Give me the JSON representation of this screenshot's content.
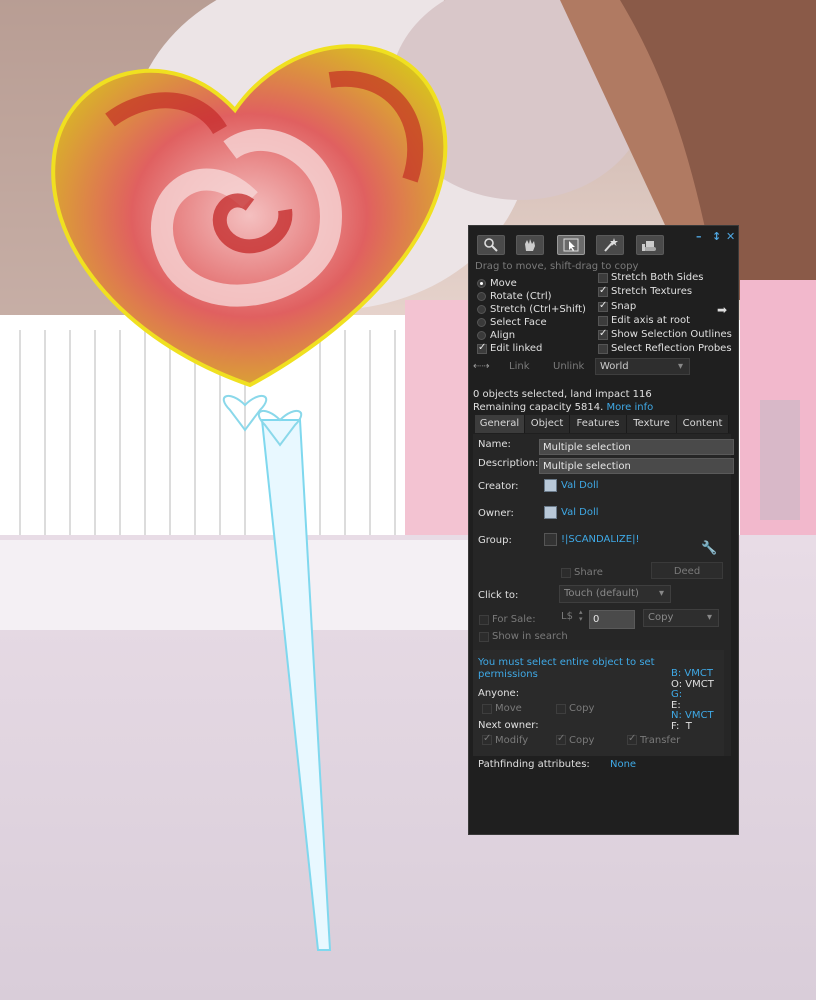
{
  "toolbar": {
    "tools": [
      {
        "icon": "magnifier-icon"
      },
      {
        "icon": "grab-hand-icon"
      },
      {
        "icon": "build-pointer-icon"
      },
      {
        "icon": "magic-wand-create-icon"
      },
      {
        "icon": "bulldozer-land-icon"
      }
    ],
    "hint": "Drag to move, shift-drag to copy"
  },
  "modes": [
    {
      "label": "Move",
      "selected": true
    },
    {
      "label": "Rotate (Ctrl)",
      "selected": false
    },
    {
      "label": "Stretch (Ctrl+Shift)",
      "selected": false
    },
    {
      "label": "Select Face",
      "selected": false
    },
    {
      "label": "Align",
      "selected": false
    }
  ],
  "edit_linked": {
    "label": "Edit linked",
    "checked": true
  },
  "options": [
    {
      "label": "Stretch Both Sides",
      "checked": false
    },
    {
      "label": "Stretch Textures",
      "checked": true
    },
    {
      "label": "Snap",
      "checked": true
    },
    {
      "label": "Edit axis at root",
      "checked": false
    },
    {
      "label": "Show Selection Outlines",
      "checked": true
    },
    {
      "label": "Select Reflection Probes",
      "checked": false
    }
  ],
  "link_row": {
    "link": "Link",
    "unlink": "Unlink",
    "ruler": "World"
  },
  "status": {
    "line1": "0 objects selected, land impact 116",
    "line2": "Remaining capacity 5814.",
    "more_info": "More info"
  },
  "tabs": [
    "General",
    "Object",
    "Features",
    "Texture",
    "Content"
  ],
  "general": {
    "name_label": "Name:",
    "name_value": "Multiple selection",
    "description_label": "Description:",
    "description_value": "Multiple selection",
    "creator_label": "Creator:",
    "creator_value": "Val Doll",
    "owner_label": "Owner:",
    "owner_value": "Val Doll",
    "group_label": "Group:",
    "group_value": "!|SCANDALIZE|!",
    "share_label": "Share",
    "deed_label": "Deed",
    "click_to_label": "Click to:",
    "click_to_value": "Touch  (default)",
    "for_sale_label": "For Sale:",
    "currency": "L$",
    "price": "0",
    "sale_type": "Copy",
    "show_in_search": "Show in search"
  },
  "permissions": {
    "notice": "You must select entire object to set permissions",
    "anyone_label": "Anyone:",
    "anyone_move": "Move",
    "anyone_copy": "Copy",
    "next_owner_label": "Next owner:",
    "next_modify": "Modify",
    "next_copy": "Copy",
    "next_transfer": "Transfer",
    "codes": [
      {
        "key": "B:",
        "value": "VMCT",
        "style": "link"
      },
      {
        "key": "O:",
        "value": "VMCT",
        "style": "white"
      },
      {
        "key": "G:",
        "value": "",
        "style": "link"
      },
      {
        "key": "E:",
        "value": "",
        "style": "white"
      },
      {
        "key": "N:",
        "value": "VMCT",
        "style": "link"
      },
      {
        "key": "F:",
        "value": "T",
        "style": "white"
      }
    ]
  },
  "pathfinding": {
    "label": "Pathfinding attributes:",
    "value": "None"
  },
  "colors": {
    "accent": "#3fa9e6",
    "panel_bg": "#1f1f1f"
  }
}
